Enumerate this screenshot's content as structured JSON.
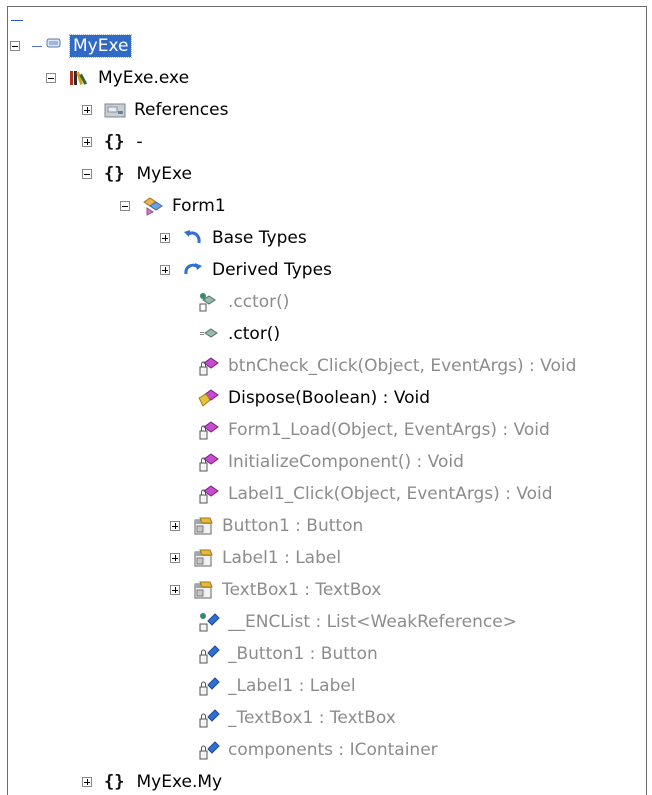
{
  "tree": {
    "root": {
      "label": "MyExe"
    },
    "assembly": {
      "label": "MyExe.exe"
    },
    "references": {
      "label": "References"
    },
    "ns_empty": {
      "brace": "{}",
      "label": "-"
    },
    "ns_myexe": {
      "brace": "{}",
      "label": "MyExe"
    },
    "form1": {
      "label": "Form1"
    },
    "base_types": {
      "label": "Base Types"
    },
    "derived_types": {
      "label": "Derived Types"
    },
    "members": [
      {
        "label": ".cctor()",
        "icon": "static-method-icon"
      },
      {
        "label": ".ctor()",
        "icon": "method-icon"
      },
      {
        "label": "btnCheck_Click(Object, EventArgs) : Void",
        "icon": "private-method-icon"
      },
      {
        "label": "Dispose(Boolean) : Void",
        "icon": "protected-method-icon"
      },
      {
        "label": "Form1_Load(Object, EventArgs) : Void",
        "icon": "private-method-icon"
      },
      {
        "label": "InitializeComponent() : Void",
        "icon": "private-method-icon"
      },
      {
        "label": "Label1_Click(Object, EventArgs) : Void",
        "icon": "private-method-icon"
      }
    ],
    "properties": [
      {
        "label": "Button1 : Button",
        "icon": "property-icon"
      },
      {
        "label": "Label1 : Label",
        "icon": "property-icon"
      },
      {
        "label": "TextBox1 : TextBox",
        "icon": "property-icon"
      }
    ],
    "fields": [
      {
        "label": "__ENCList : List<WeakReference>",
        "icon": "static-field-icon"
      },
      {
        "label": "_Button1 : Button",
        "icon": "private-field-icon"
      },
      {
        "label": "_Label1 : Label",
        "icon": "private-field-icon"
      },
      {
        "label": "_TextBox1 : TextBox",
        "icon": "private-field-icon"
      },
      {
        "label": "components : IContainer",
        "icon": "private-field-icon"
      }
    ],
    "ns_my": {
      "brace": "{}",
      "label": "MyExe.My"
    }
  }
}
